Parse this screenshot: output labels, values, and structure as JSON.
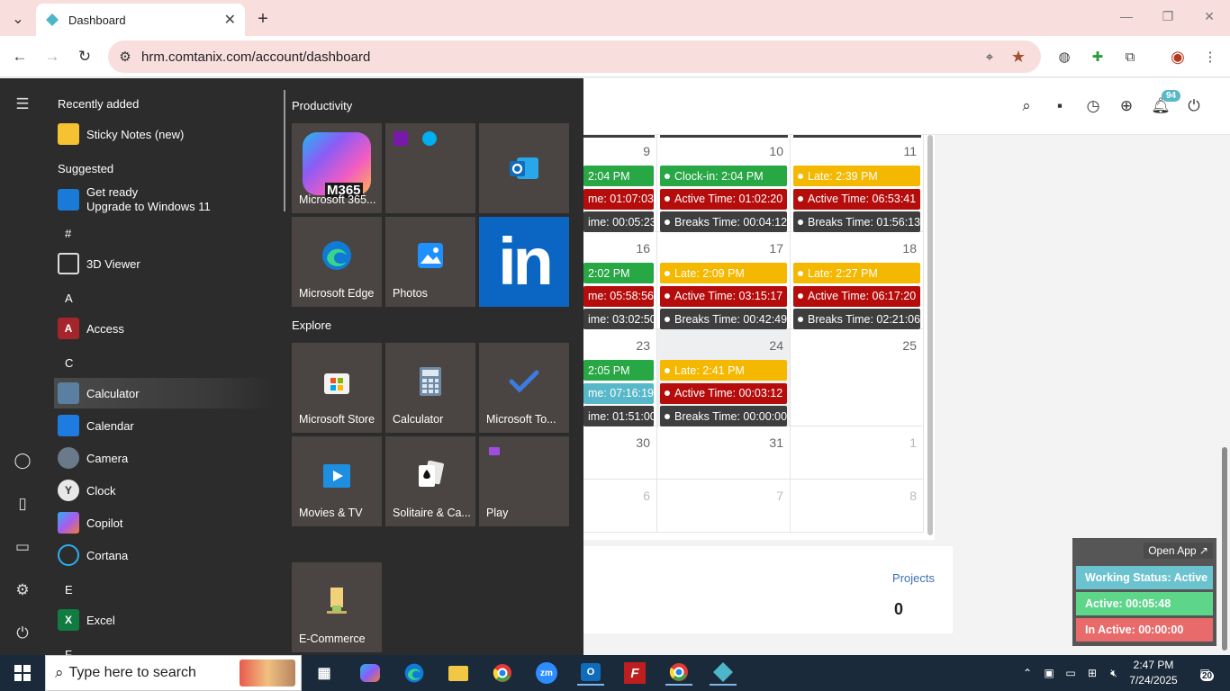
{
  "browser": {
    "tab_title": "Dashboard",
    "url": "hrm.comtanix.com/account/dashboard"
  },
  "header": {
    "notification_count": "94"
  },
  "calendar": {
    "cells": [
      {
        "day": "9",
        "events": [
          {
            "text": "2:04 PM",
            "color": "green",
            "dot": false
          },
          {
            "text": "me: 01:07:03",
            "color": "red",
            "dot": false
          },
          {
            "text": "ime: 00:05:23",
            "color": "dark",
            "dot": false
          }
        ]
      },
      {
        "day": "10",
        "events": [
          {
            "text": "Clock-in: 2:04 PM",
            "color": "green",
            "dot": true
          },
          {
            "text": "Active Time: 01:02:20",
            "color": "red",
            "dot": true
          },
          {
            "text": "Breaks Time: 00:04:12",
            "color": "dark",
            "dot": true
          }
        ]
      },
      {
        "day": "11",
        "events": [
          {
            "text": "Late: 2:39 PM",
            "color": "yellow",
            "dot": true
          },
          {
            "text": "Active Time: 06:53:41",
            "color": "red",
            "dot": true
          },
          {
            "text": "Breaks Time: 01:56:13",
            "color": "dark",
            "dot": true
          }
        ]
      },
      {
        "day": "16",
        "events": [
          {
            "text": "2:02 PM",
            "color": "green",
            "dot": false
          },
          {
            "text": "me: 05:58:56",
            "color": "red",
            "dot": false
          },
          {
            "text": "ime: 03:02:50",
            "color": "dark",
            "dot": false
          }
        ]
      },
      {
        "day": "17",
        "events": [
          {
            "text": "Late: 2:09 PM",
            "color": "yellow",
            "dot": true
          },
          {
            "text": "Active Time: 03:15:17",
            "color": "red",
            "dot": true
          },
          {
            "text": "Breaks Time: 00:42:49",
            "color": "dark",
            "dot": true
          }
        ]
      },
      {
        "day": "18",
        "events": [
          {
            "text": "Late: 2:27 PM",
            "color": "yellow",
            "dot": true
          },
          {
            "text": "Active Time: 06:17:20",
            "color": "red",
            "dot": true
          },
          {
            "text": "Breaks Time: 02:21:06",
            "color": "dark",
            "dot": true
          }
        ]
      },
      {
        "day": "23",
        "events": [
          {
            "text": "2:05 PM",
            "color": "green",
            "dot": false
          },
          {
            "text": "me: 07:16:19",
            "color": "teal",
            "dot": false
          },
          {
            "text": "ime: 01:51:00",
            "color": "dark",
            "dot": false
          }
        ]
      },
      {
        "day": "24",
        "events": [
          {
            "text": "Late: 2:41 PM",
            "color": "yellow",
            "dot": true
          },
          {
            "text": "Active Time: 00:03:12",
            "color": "red",
            "dot": true
          },
          {
            "text": "Breaks Time: 00:00:00",
            "color": "dark",
            "dot": true
          }
        ]
      },
      {
        "day": "25",
        "events": []
      },
      {
        "day": "30",
        "events": []
      },
      {
        "day": "31",
        "events": []
      },
      {
        "day": "1",
        "events": []
      },
      {
        "day": "6",
        "events": []
      },
      {
        "day": "7",
        "events": []
      },
      {
        "day": "8",
        "events": []
      }
    ]
  },
  "projects": {
    "label": "Projects",
    "value": "0"
  },
  "status_panel": {
    "open_app": "Open App ↗",
    "working_status": "Working Status: Active",
    "active": "Active: 00:05:48",
    "inactive": "In Active: 00:00:00"
  },
  "start_menu": {
    "recently_added": "Recently added",
    "sticky_notes": "Sticky Notes (new)",
    "suggested": "Suggested",
    "get_ready_line1": "Get ready",
    "get_ready_line2": "Upgrade to Windows 11",
    "letter_hash": "#",
    "viewer3d": "3D Viewer",
    "letter_a": "A",
    "access": "Access",
    "letter_c": "C",
    "calculator": "Calculator",
    "calendar": "Calendar",
    "camera": "Camera",
    "clock": "Clock",
    "copilot": "Copilot",
    "cortana": "Cortana",
    "letter_e": "E",
    "excel": "Excel",
    "letter_f": "F",
    "productivity": "Productivity",
    "explore": "Explore",
    "tiles": {
      "m365": "Microsoft 365...",
      "m365_badge": "M365",
      "edge": "Microsoft Edge",
      "photos": "Photos",
      "store": "Microsoft Store",
      "calculator": "Calculator",
      "todo": "Microsoft To...",
      "movies": "Movies & TV",
      "solitaire": "Solitaire & Ca...",
      "play": "Play",
      "ecommerce": "E-Commerce"
    }
  },
  "taskbar": {
    "search_placeholder": "Type here to search",
    "time": "2:47 PM",
    "date": "7/24/2025",
    "notif": "20"
  },
  "colors": {
    "green": "#28a745",
    "yellow": "#f5b800",
    "red": "#b50c0c",
    "dark": "#3e3e3e",
    "teal": "#56b8c8",
    "status_working": "#6cc3d0",
    "status_active": "#5ed68a",
    "status_inactive": "#e86a6a"
  }
}
